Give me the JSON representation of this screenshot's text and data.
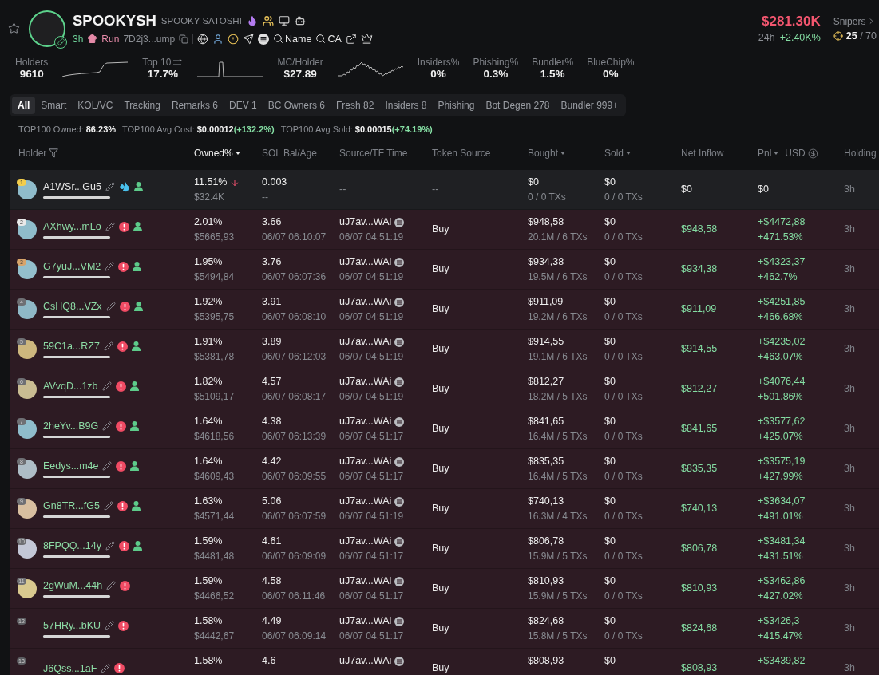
{
  "token": {
    "symbol": "SPOOKYSH",
    "name": "SPOOKY SATOSHI",
    "age": "3h",
    "platform": "Run",
    "address": "7D2j3...ump",
    "searches": [
      "Name",
      "CA"
    ]
  },
  "market": {
    "cap": "$281.30K",
    "period": "24h",
    "change": "+2.40K%"
  },
  "snipers": {
    "label": "Snipers",
    "value": "**25** / 70"
  },
  "stats": [
    {
      "label": "Holders",
      "value": "9610",
      "kind": "step"
    },
    {
      "label": "Top 10",
      "value": "17.7%",
      "kind": "spike",
      "sortable": true
    },
    {
      "label": "MC/Holder",
      "value": "$27.89",
      "kind": "wave"
    },
    {
      "label": "Insiders%",
      "value": "0%",
      "kind": "plain"
    },
    {
      "label": "Phishing%",
      "value": "0.3%",
      "kind": "plain"
    },
    {
      "label": "Bundler%",
      "value": "1.5%",
      "kind": "plain"
    },
    {
      "label": "BlueChip%",
      "value": "0%",
      "kind": "plain"
    }
  ],
  "tabs": [
    {
      "label": "All",
      "selected": true
    },
    {
      "label": "Smart",
      "selected": false
    },
    {
      "label": "KOL/VC",
      "selected": false
    },
    {
      "label": "Tracking",
      "selected": false
    },
    {
      "label": "Remarks 6",
      "selected": false
    },
    {
      "label": "DEV 1",
      "selected": false
    },
    {
      "label": "BC Owners 6",
      "selected": false
    },
    {
      "label": "Fresh 82",
      "selected": false
    },
    {
      "label": "Insiders 8",
      "selected": false
    },
    {
      "label": "Phishing",
      "selected": false
    },
    {
      "label": "Bot Degen 278",
      "selected": false
    },
    {
      "label": "Bundler 999+",
      "selected": false
    }
  ],
  "summary": [
    {
      "label": "TOP100 Owned:",
      "value": "86.23%"
    },
    {
      "label": "TOP100 Avg Cost:",
      "value": "$0.00012",
      "change": "(+132.2%)"
    },
    {
      "label": "TOP100 Avg Sold:",
      "value": "$0.00015",
      "change": "(+74.19%)"
    }
  ],
  "table": {
    "columns": [
      {
        "label": "Holder",
        "selected": false,
        "filter": true
      },
      {
        "label": "Owned%",
        "selected": true,
        "sort": true
      },
      {
        "label": "SOL Bal/Age",
        "selected": false
      },
      {
        "label": "Source/TF Time",
        "selected": false
      },
      {
        "label": "Token Source",
        "selected": false
      },
      {
        "label": "Bought",
        "selected": false,
        "sort": true
      },
      {
        "label": "Sold",
        "selected": false,
        "sort": true
      },
      {
        "label": "Net Inflow",
        "selected": false
      },
      {
        "label": "Pnl",
        "selected": false,
        "sort": true,
        "unit": "USD"
      },
      {
        "label": "Holding",
        "selected": false
      }
    ],
    "rows": [
      {
        "kind": "pool",
        "rank": {
          "text": "1",
          "color": "#f3cd4b"
        },
        "avatar": {
          "color": "#8fbccb"
        },
        "name": "A1WSr...Gu5",
        "icons": [
          {
            "kind": "liquidity"
          },
          {
            "kind": "person"
          }
        ],
        "level": 1,
        "owned": "11.51%",
        "owned_falling": true,
        "owned_value": "$32.4K",
        "sol": "0.003",
        "age": "--",
        "source": {
          "text": "--",
          "icon": false
        },
        "token_source": "--",
        "bought": "$0",
        "bought_detail": "0 / 0 TXs",
        "sold": "$0",
        "sold_detail": "0 / 0 TXs",
        "net_inflow": "$0",
        "pnl": "$0",
        "holding": "3h"
      },
      {
        "kind": "holder",
        "rank": {
          "text": "2",
          "color": "#e9e9e9"
        },
        "avatar": {
          "color": "#8fbccb"
        },
        "name": "AXhwy...mLo",
        "icons": [
          {
            "kind": "warning"
          },
          {
            "kind": "person"
          }
        ],
        "level": 1,
        "owned": "2.01%",
        "owned_value": "$5665,93",
        "sol": "3.66",
        "age": "06/07 06:10:07",
        "source": {
          "text": "uJ7av...WAi",
          "icon": true,
          "time": "06/07 04:51:19"
        },
        "token_source": "Buy",
        "bought": "$948,58",
        "bought_detail": "20.1M / 6 TXs",
        "sold": "$0",
        "sold_detail": "0 / 0 TXs",
        "net_inflow": "$948,58",
        "pnl": "+$4472,88",
        "pnl_percent": "+471.53%",
        "holding": "3h"
      },
      {
        "kind": "holder",
        "rank": {
          "text": "3",
          "color": "#d8a46a"
        },
        "avatar": {
          "color": "#93bfcc"
        },
        "name": "G7yuJ...VM2",
        "icons": [
          {
            "kind": "warning"
          },
          {
            "kind": "person"
          }
        ],
        "level": 1,
        "owned": "1.95%",
        "owned_value": "$5494,84",
        "sol": "3.76",
        "age": "06/07 06:07:36",
        "source": {
          "text": "uJ7av...WAi",
          "icon": true,
          "time": "06/07 04:51:19"
        },
        "token_source": "Buy",
        "bought": "$934,38",
        "bought_detail": "19.5M / 6 TXs",
        "sold": "$0",
        "sold_detail": "0 / 0 TXs",
        "net_inflow": "$934,38",
        "pnl": "+$4323,37",
        "pnl_percent": "+462.7%",
        "holding": "3h"
      },
      {
        "kind": "holder",
        "rank": {
          "text": "4",
          "color": "#6e6f73"
        },
        "avatar": {
          "color": "#8fb8c6"
        },
        "name": "CsHQ8...VZx",
        "icons": [
          {
            "kind": "warning"
          },
          {
            "kind": "person"
          }
        ],
        "level": 1,
        "owned": "1.92%",
        "owned_value": "$5395,75",
        "sol": "3.91",
        "age": "06/07 06:08:10",
        "source": {
          "text": "uJ7av...WAi",
          "icon": true,
          "time": "06/07 04:51:19"
        },
        "token_source": "Buy",
        "bought": "$911,09",
        "bought_detail": "19.2M / 6 TXs",
        "sold": "$0",
        "sold_detail": "0 / 0 TXs",
        "net_inflow": "$911,09",
        "pnl": "+$4251,85",
        "pnl_percent": "+466.68%",
        "holding": "3h"
      },
      {
        "kind": "holder",
        "rank": {
          "text": "5",
          "color": "#6e6f73"
        },
        "avatar": {
          "color": "#cdb77e"
        },
        "name": "59C1a...RZ7",
        "icons": [
          {
            "kind": "warning"
          },
          {
            "kind": "person"
          }
        ],
        "level": 1,
        "owned": "1.91%",
        "owned_value": "$5381,78",
        "sol": "3.89",
        "age": "06/07 06:12:03",
        "source": {
          "text": "uJ7av...WAi",
          "icon": true,
          "time": "06/07 04:51:19"
        },
        "token_source": "Buy",
        "bought": "$914,55",
        "bought_detail": "19.1M / 6 TXs",
        "sold": "$0",
        "sold_detail": "0 / 0 TXs",
        "net_inflow": "$914,55",
        "pnl": "+$4235,02",
        "pnl_percent": "+463.07%",
        "holding": "3h"
      },
      {
        "kind": "holder",
        "rank": {
          "text": "6",
          "color": "#6e6f73"
        },
        "avatar": {
          "color": "#c9bc92"
        },
        "name": "AVvqD...1zb",
        "icons": [
          {
            "kind": "warning"
          },
          {
            "kind": "person"
          }
        ],
        "level": 1,
        "owned": "1.82%",
        "owned_value": "$5109,17",
        "sol": "4.57",
        "age": "06/07 06:08:17",
        "source": {
          "text": "uJ7av...WAi",
          "icon": true,
          "time": "06/07 04:51:19"
        },
        "token_source": "Buy",
        "bought": "$812,27",
        "bought_detail": "18.2M / 5 TXs",
        "sold": "$0",
        "sold_detail": "0 / 0 TXs",
        "net_inflow": "$812,27",
        "pnl": "+$4076,44",
        "pnl_percent": "+501.86%",
        "holding": "3h"
      },
      {
        "kind": "holder",
        "rank": {
          "text": "7",
          "color": "#6e6f73"
        },
        "avatar": {
          "color": "#8fbccb"
        },
        "name": "2heYv...B9G",
        "icons": [
          {
            "kind": "warning"
          },
          {
            "kind": "person"
          }
        ],
        "level": 1,
        "owned": "1.64%",
        "owned_value": "$4618,56",
        "sol": "4.38",
        "age": "06/07 06:13:39",
        "source": {
          "text": "uJ7av...WAi",
          "icon": true,
          "time": "06/07 04:51:17"
        },
        "token_source": "Buy",
        "bought": "$841,65",
        "bought_detail": "16.4M / 5 TXs",
        "sold": "$0",
        "sold_detail": "0 / 0 TXs",
        "net_inflow": "$841,65",
        "pnl": "+$3577,62",
        "pnl_percent": "+425.07%",
        "holding": "3h"
      },
      {
        "kind": "holder",
        "rank": {
          "text": "8",
          "color": "#6e6f73"
        },
        "avatar": {
          "color": "#aebdc6"
        },
        "name": "Eedys...m4e",
        "icons": [
          {
            "kind": "warning"
          },
          {
            "kind": "person"
          }
        ],
        "level": 1,
        "owned": "1.64%",
        "owned_value": "$4609,43",
        "sol": "4.42",
        "age": "06/07 06:09:55",
        "source": {
          "text": "uJ7av...WAi",
          "icon": true,
          "time": "06/07 04:51:17"
        },
        "token_source": "Buy",
        "bought": "$835,35",
        "bought_detail": "16.4M / 5 TXs",
        "sold": "$0",
        "sold_detail": "0 / 0 TXs",
        "net_inflow": "$835,35",
        "pnl": "+$3575,19",
        "pnl_percent": "+427.99%",
        "holding": "3h"
      },
      {
        "kind": "holder",
        "rank": {
          "text": "9",
          "color": "#6e6f73"
        },
        "avatar": {
          "color": "#d8bfa0"
        },
        "name": "Gn8TR...fG5",
        "icons": [
          {
            "kind": "warning"
          },
          {
            "kind": "person"
          }
        ],
        "level": 1,
        "owned": "1.63%",
        "owned_value": "$4571,44",
        "sol": "5.06",
        "age": "06/07 06:07:59",
        "source": {
          "text": "uJ7av...WAi",
          "icon": true,
          "time": "06/07 04:51:19"
        },
        "token_source": "Buy",
        "bought": "$740,13",
        "bought_detail": "16.3M / 4 TXs",
        "sold": "$0",
        "sold_detail": "0 / 0 TXs",
        "net_inflow": "$740,13",
        "pnl": "+$3634,07",
        "pnl_percent": "+491.01%",
        "holding": "3h"
      },
      {
        "kind": "holder",
        "rank": {
          "text": "10",
          "color": "#6e6f73"
        },
        "avatar": {
          "color": "#c3c7d6"
        },
        "name": "8FPQQ...14y",
        "icons": [
          {
            "kind": "warning"
          },
          {
            "kind": "person"
          }
        ],
        "level": 1,
        "owned": "1.59%",
        "owned_value": "$4481,48",
        "sol": "4.61",
        "age": "06/07 06:09:09",
        "source": {
          "text": "uJ7av...WAi",
          "icon": true,
          "time": "06/07 04:51:17"
        },
        "token_source": "Buy",
        "bought": "$806,78",
        "bought_detail": "15.9M / 5 TXs",
        "sold": "$0",
        "sold_detail": "0 / 0 TXs",
        "net_inflow": "$806,78",
        "pnl": "+$3481,34",
        "pnl_percent": "+431.51%",
        "holding": "3h"
      },
      {
        "kind": "holder",
        "rank": {
          "text": "11",
          "color": "#6e6f73"
        },
        "avatar": {
          "color": "#d9c98f"
        },
        "name": "2gWuM...44h",
        "icons": [
          {
            "kind": "warning"
          }
        ],
        "level": 1,
        "owned": "1.59%",
        "owned_value": "$4466,52",
        "sol": "4.58",
        "age": "06/07 06:11:46",
        "source": {
          "text": "uJ7av...WAi",
          "icon": true,
          "time": "06/07 04:51:17"
        },
        "token_source": "Buy",
        "bought": "$810,93",
        "bought_detail": "15.9M / 5 TXs",
        "sold": "$0",
        "sold_detail": "0 / 0 TXs",
        "net_inflow": "$810,93",
        "pnl": "+$3462,86",
        "pnl_percent": "+427.02%",
        "holding": "3h"
      },
      {
        "kind": "holder",
        "rank": {
          "text": "12",
          "color": "#5c5d61"
        },
        "name": "57HRy...bKU",
        "icons": [
          {
            "kind": "warning"
          }
        ],
        "level": 1,
        "owned": "1.58%",
        "owned_value": "$4442,67",
        "sol": "4.49",
        "age": "06/07 06:09:14",
        "source": {
          "text": "uJ7av...WAi",
          "icon": true,
          "time": "06/07 04:51:17"
        },
        "token_source": "Buy",
        "bought": "$824,68",
        "bought_detail": "15.8M / 5 TXs",
        "sold": "$0",
        "sold_detail": "0 / 0 TXs",
        "net_inflow": "$824,68",
        "pnl": "+$3426,3",
        "pnl_percent": "+415.47%",
        "holding": "3h"
      },
      {
        "kind": "holder",
        "rank": {
          "text": "13",
          "color": "#5c5d61"
        },
        "name": "J6Qss...1aF",
        "icons": [
          {
            "kind": "warning"
          }
        ],
        "owned": "1.58%",
        "sol": "4.6",
        "source": {
          "text": "uJ7av...WAi",
          "icon": true
        },
        "token_source": "Buy",
        "bought": "$808,93",
        "sold": "$0",
        "net_inflow": "$808,93",
        "pnl": "+$3439,82",
        "holding": "3h"
      }
    ]
  }
}
